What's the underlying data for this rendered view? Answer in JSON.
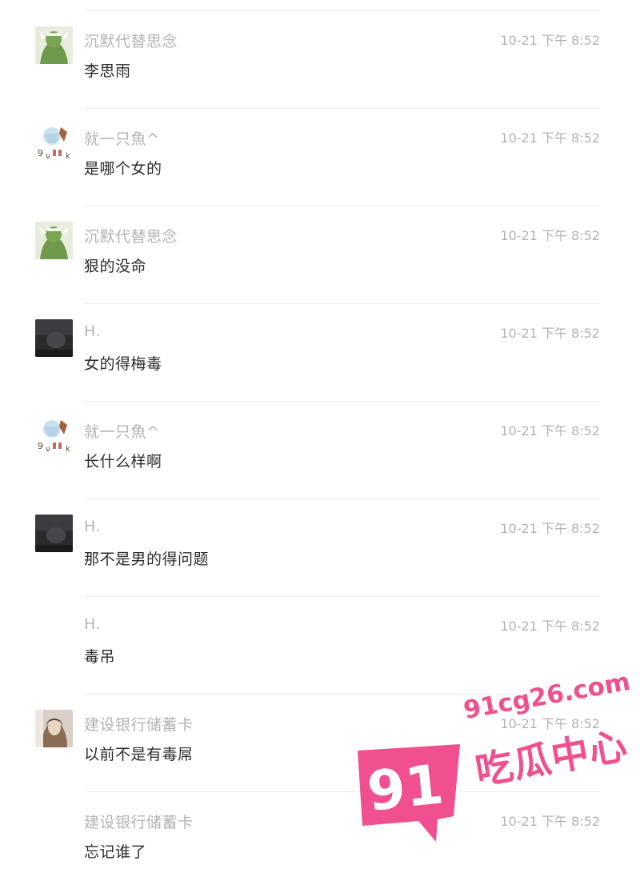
{
  "messages": [
    {
      "user": "沉默代替思念",
      "time": "10-21 下午 8:52",
      "text": "李思雨",
      "avatar": "green-character-avatar"
    },
    {
      "user": "就一只魚^",
      "time": "10-21 下午 8:52",
      "text": "是哪个女的",
      "avatar": "doodle-avatar"
    },
    {
      "user": "沉默代替思念",
      "time": "10-21 下午 8:52",
      "text": "狠的没命",
      "avatar": "green-character-avatar"
    },
    {
      "user": "H.",
      "time": "10-21 下午 8:52",
      "text": "女的得梅毒",
      "avatar": "dark-photo-avatar"
    },
    {
      "user": "就一只魚^",
      "time": "10-21 下午 8:52",
      "text": "长什么样啊",
      "avatar": "doodle-avatar"
    },
    {
      "user": "H.",
      "time": "10-21 下午 8:52",
      "text": "那不是男的得问题",
      "avatar": "dark-photo-avatar"
    },
    {
      "user": "H.",
      "time": "10-21 下午 8:52",
      "text": "毒吊",
      "avatar": ""
    },
    {
      "user": "建设银行储蓄卡",
      "time": "10-21 下午 8:52",
      "text": "以前不是有毒屌",
      "avatar": "portrait-avatar"
    },
    {
      "user": "建设银行储蓄卡",
      "time": "10-21 下午 8:52",
      "text": "忘记谁了",
      "avatar": ""
    }
  ],
  "watermark": {
    "number": "91",
    "url": "91cg26.com",
    "text": "吃瓜中心",
    "color": "#f0508f"
  }
}
